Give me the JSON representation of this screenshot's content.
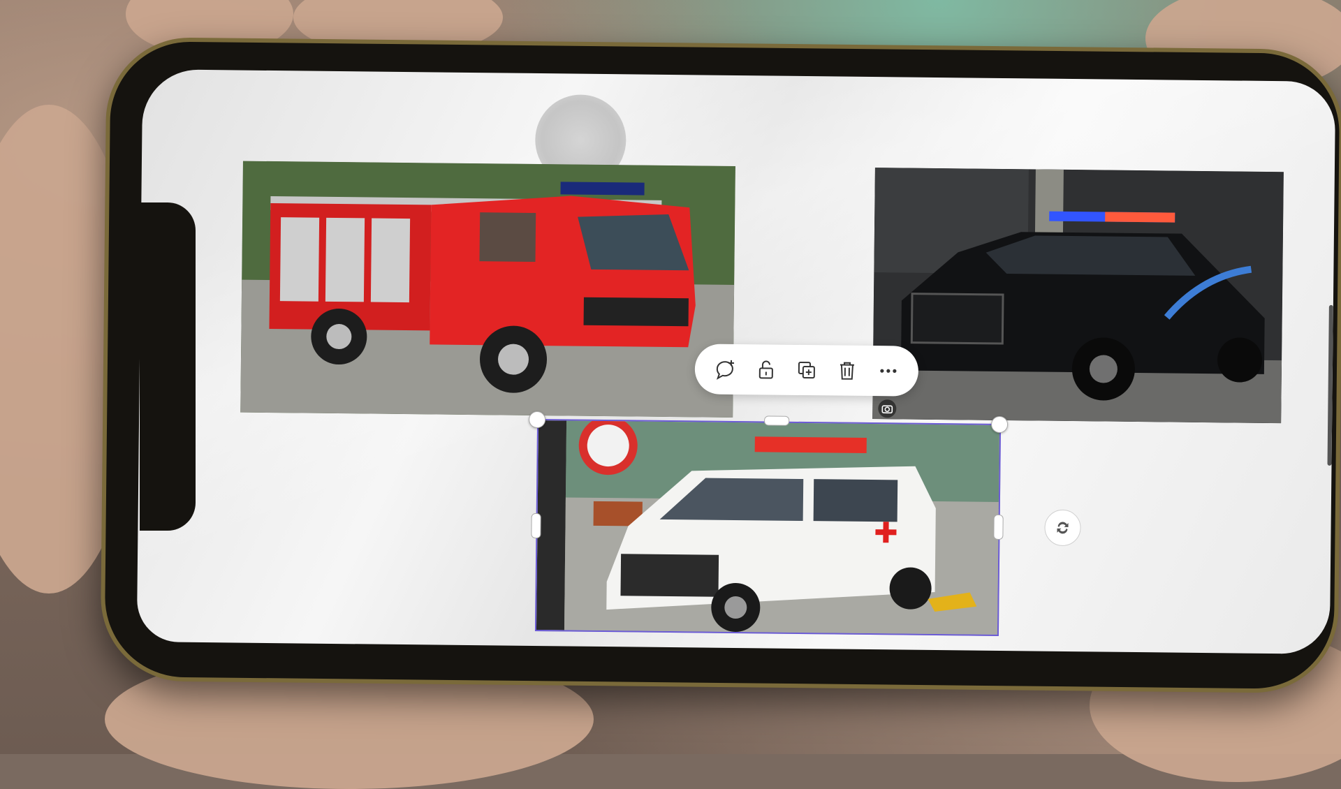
{
  "images": [
    {
      "label": "fire-truck-photo"
    },
    {
      "label": "police-car-photo"
    },
    {
      "label": "ambulance-photo"
    }
  ],
  "toolbar": {
    "items": [
      {
        "icon": "add-comment-icon"
      },
      {
        "icon": "unlock-icon"
      },
      {
        "icon": "duplicate-icon"
      },
      {
        "icon": "delete-icon"
      },
      {
        "icon": "more-icon"
      }
    ]
  },
  "colors": {
    "selection": "#6b5bd6",
    "toolbar_bg": "#ffffff",
    "canvas_bg": "#f2f2f2"
  }
}
